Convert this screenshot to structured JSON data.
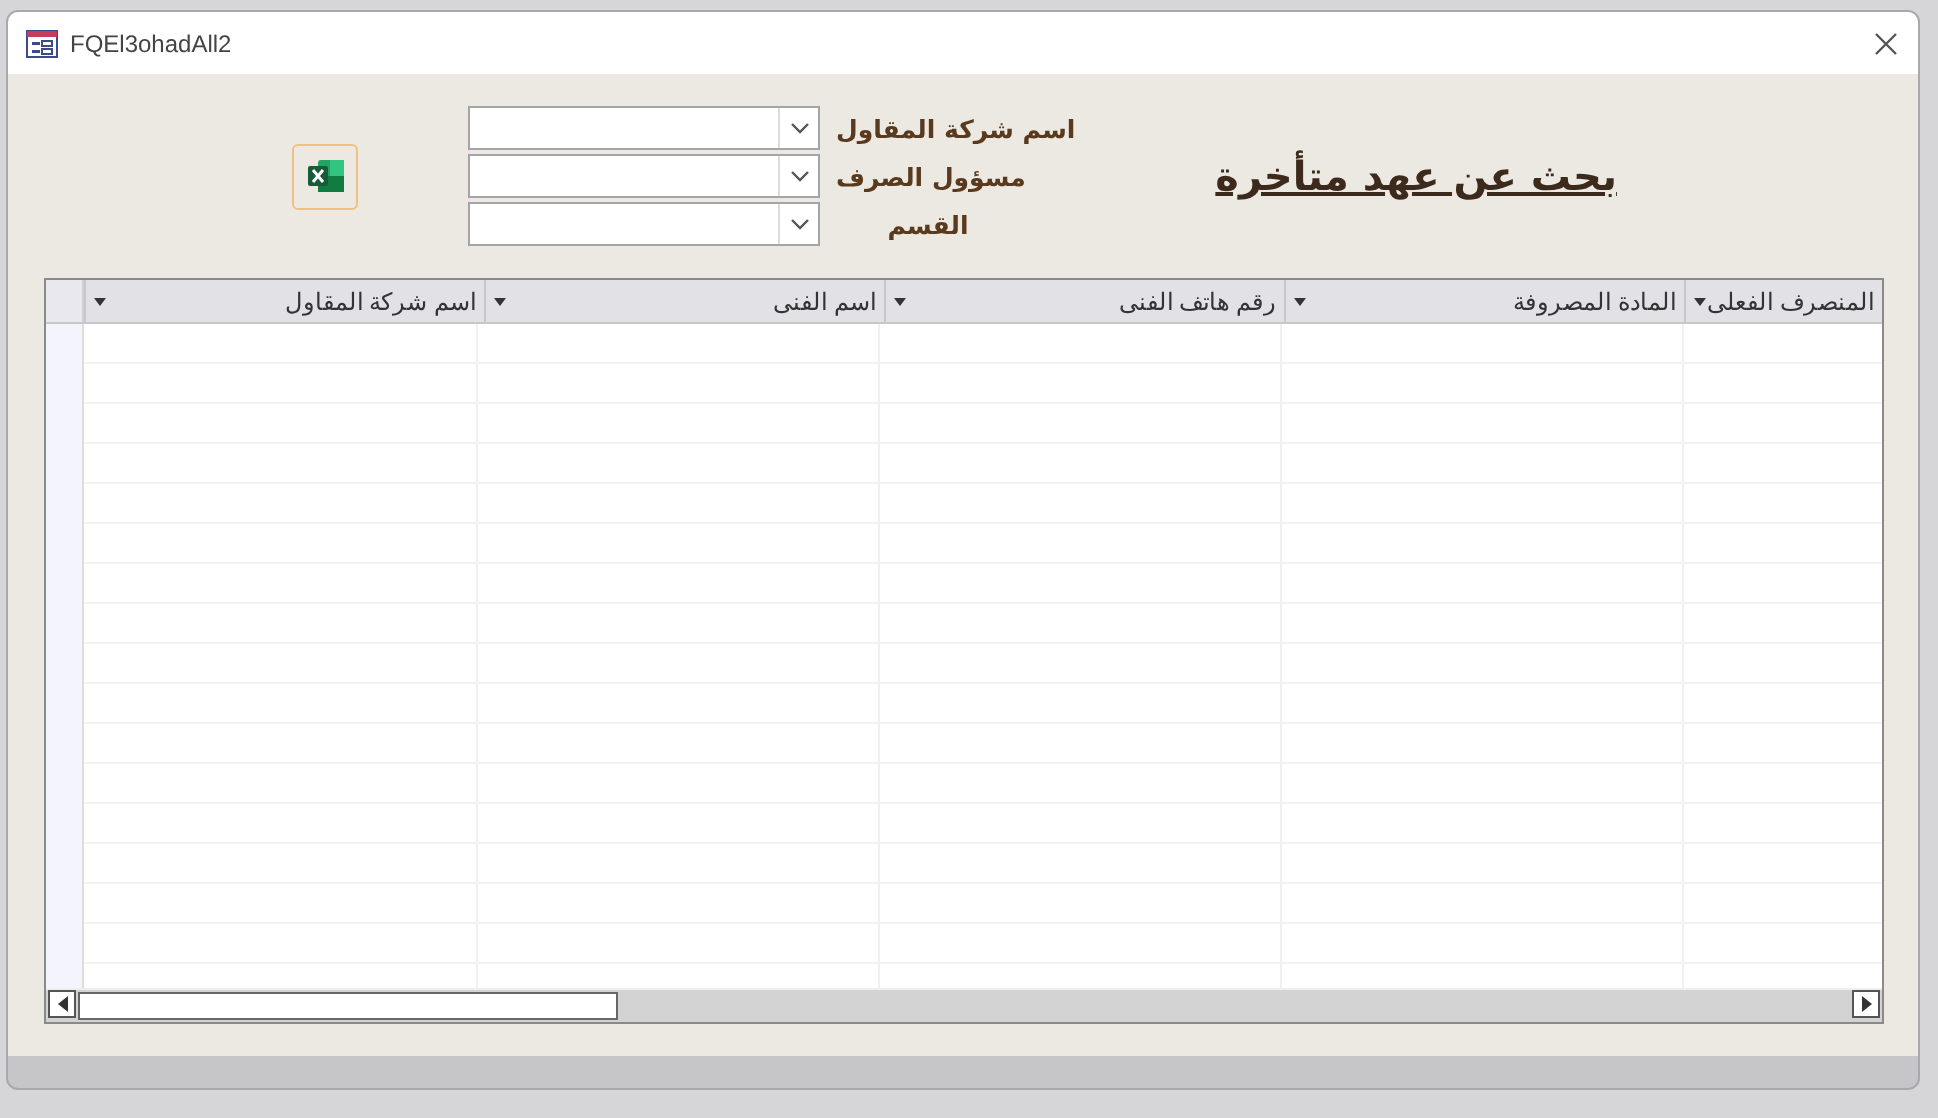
{
  "window": {
    "title": "FQEl3ohadAll2"
  },
  "heading": "بحث عن عهد متأخرة",
  "filters": [
    {
      "label": "اسم شركة المقاول"
    },
    {
      "label": "مسؤول الصرف"
    },
    {
      "label": "القسم"
    }
  ],
  "table": {
    "columns": [
      "المنصرف الفعلى",
      "المادة المصروفة",
      "رقم هاتف الفنى",
      "اسم الفنى",
      "اسم شركة المقاول"
    ]
  }
}
